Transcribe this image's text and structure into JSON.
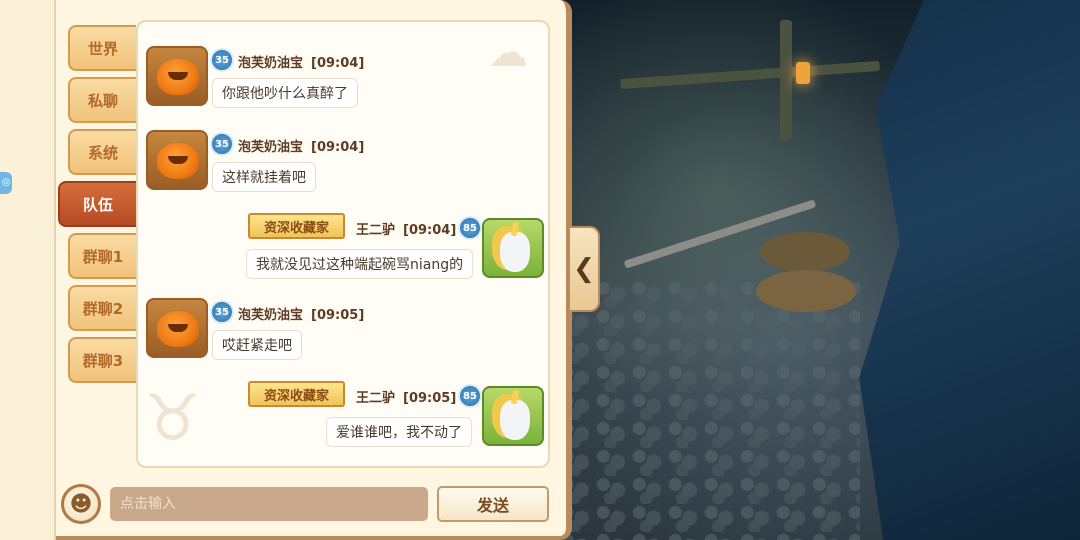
{
  "tabs": [
    {
      "label": "世界",
      "active": false
    },
    {
      "label": "私聊",
      "active": false
    },
    {
      "label": "系统",
      "active": false
    },
    {
      "label": "队伍",
      "active": true
    },
    {
      "label": "群聊1",
      "active": false
    },
    {
      "label": "群聊2",
      "active": false
    },
    {
      "label": "群聊3",
      "active": false
    }
  ],
  "messages": [
    {
      "side": "left",
      "avatar": "pumpkin-avatar",
      "level": "35",
      "name": "泡芙奶油宝",
      "time": "[09:04]",
      "text": "你跟他吵什么真醉了"
    },
    {
      "side": "left",
      "avatar": "pumpkin-avatar",
      "level": "35",
      "name": "泡芙奶油宝",
      "time": "[09:04]",
      "text": "这样就挂着吧"
    },
    {
      "side": "right",
      "avatar": "unicorn-avatar",
      "level": "85",
      "title": "资深收藏家",
      "name": "王二驴",
      "time": "[09:04]",
      "text": "我就没见过这种端起碗骂niang的"
    },
    {
      "side": "left",
      "avatar": "pumpkin-avatar",
      "level": "35",
      "name": "泡芙奶油宝",
      "time": "[09:05]",
      "text": "哎赶紧走吧"
    },
    {
      "side": "right",
      "avatar": "unicorn-avatar",
      "level": "85",
      "title": "资深收藏家",
      "name": "王二驴",
      "time": "[09:05]",
      "text": "爱谁谁吧，我不动了"
    }
  ],
  "input": {
    "placeholder": "点击输入",
    "value": ""
  },
  "send_label": "发送",
  "icons": {
    "emoji": "smiley-face-icon",
    "collapse": "chevron-left-icon"
  },
  "colors": {
    "tab_active": "#c05a2c",
    "tab_inactive": "#f5cf8e",
    "title_badge": "#f6d06e",
    "level_badge": "#4a8fc8"
  }
}
